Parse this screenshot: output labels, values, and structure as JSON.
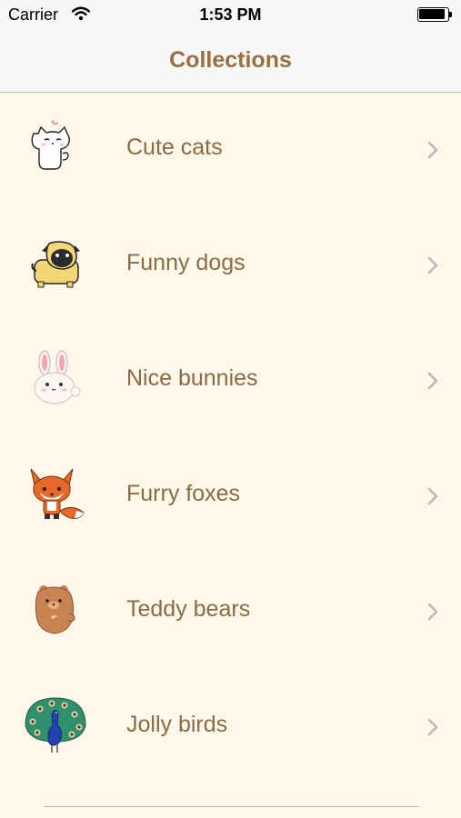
{
  "status_bar": {
    "carrier": "Carrier",
    "time": "1:53 PM",
    "battery_level": 0.95,
    "wifi_icon": "wifi-icon",
    "battery_icon": "battery-icon"
  },
  "nav": {
    "title": "Collections"
  },
  "collections": [
    {
      "label": "Cute cats",
      "icon": "cat-icon"
    },
    {
      "label": "Funny dogs",
      "icon": "pug-icon"
    },
    {
      "label": "Nice bunnies",
      "icon": "bunny-icon"
    },
    {
      "label": "Furry foxes",
      "icon": "fox-icon"
    },
    {
      "label": "Teddy bears",
      "icon": "bear-icon"
    },
    {
      "label": "Jolly birds",
      "icon": "peacock-icon"
    }
  ],
  "colors": {
    "background": "#fef8ea",
    "accent": "#98703f",
    "chevron": "#b8b8b8"
  }
}
